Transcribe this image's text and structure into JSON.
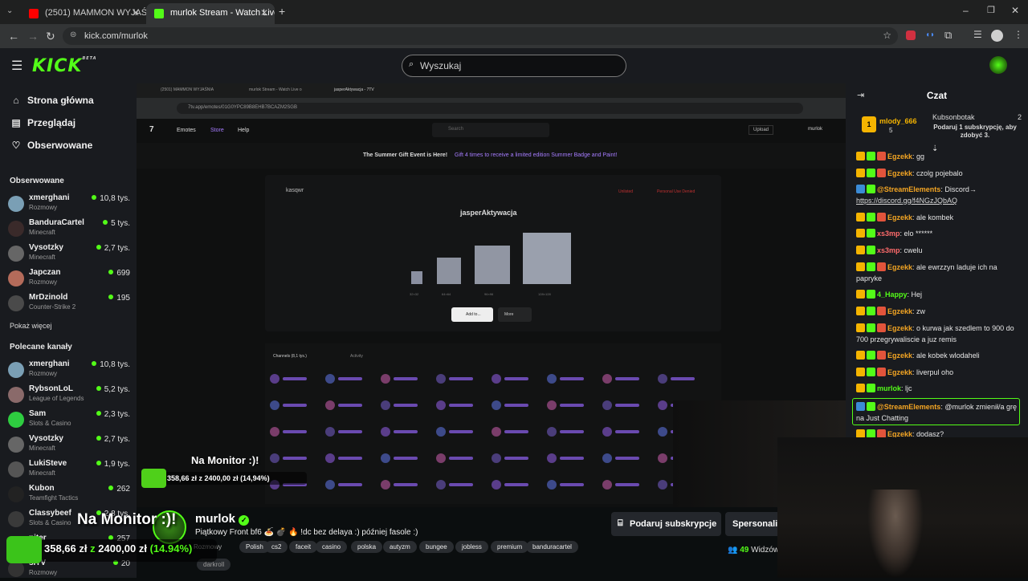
{
  "browser": {
    "tabs": [
      {
        "label": "(2501) MAMMON WYJAŚNIA ST",
        "active": false,
        "color": "#ff0000"
      },
      {
        "label": "murlok Stream - Watch Live on",
        "active": true,
        "color": "#53fc18"
      }
    ],
    "url": "kick.com/murlok"
  },
  "header": {
    "logo": "KICK",
    "logo_beta": "BETA",
    "search_placeholder": "Wyszukaj"
  },
  "sidebar": {
    "nav": [
      {
        "label": "Strona główna",
        "icon": "home-icon"
      },
      {
        "label": "Przeglądaj",
        "icon": "browse-icon"
      },
      {
        "label": "Obserwowane",
        "icon": "heart-icon"
      }
    ],
    "followed_title": "Obserwowane",
    "followed": [
      {
        "name": "xmerghani",
        "category": "Rozmowy",
        "viewers": "10,8 tys.",
        "color": "#7a9fb5"
      },
      {
        "name": "BanduraCartel",
        "category": "Minecraft",
        "viewers": "5 tys.",
        "color": "#3a2a2a"
      },
      {
        "name": "Vysotzky",
        "category": "Minecraft",
        "viewers": "2,7 tys.",
        "color": "#666"
      },
      {
        "name": "Japczan",
        "category": "Rozmowy",
        "viewers": "699",
        "color": "#b46b5a"
      },
      {
        "name": "MrDzinold",
        "category": "Counter-Strike 2",
        "viewers": "195",
        "color": "#4a4a4a"
      }
    ],
    "show_more": "Pokaż więcej",
    "recommended_title": "Polecane kanały",
    "recommended": [
      {
        "name": "xmerghani",
        "category": "Rozmowy",
        "viewers": "10,8 tys.",
        "color": "#7a9fb5"
      },
      {
        "name": "RybsonLoL",
        "category": "League of Legends",
        "viewers": "5,2 tys.",
        "color": "#8a6a6a"
      },
      {
        "name": "Sam",
        "category": "Slots & Casino",
        "viewers": "2,3 tys.",
        "color": "#2ecc40"
      },
      {
        "name": "Vysotzky",
        "category": "Minecraft",
        "viewers": "2,7 tys.",
        "color": "#666"
      },
      {
        "name": "LukiSteve",
        "category": "Minecraft",
        "viewers": "1,9 tys.",
        "color": "#555"
      },
      {
        "name": "Kubon",
        "category": "Teamfight Tactics",
        "viewers": "262",
        "color": "#222"
      },
      {
        "name": "Classybeef",
        "category": "Slots & Casino",
        "viewers": "2,8 tys.",
        "color": "#3a3a3a"
      },
      {
        "name": "piter",
        "category": "",
        "viewers": "257",
        "color": "#444"
      },
      {
        "name": "sITV",
        "category": "Rozmowy",
        "viewers": "20",
        "color": "#333"
      }
    ]
  },
  "stream": {
    "inner_browser": {
      "tabs": [
        "(2501) MAMMON WYJAŚNIA",
        "murlok Stream - Watch Live o",
        "jasperAktywacja - 7TV"
      ],
      "url": "7tv.app/emotes/01G0YPC89B8EHB7BCAZM2SGB",
      "nav": [
        "Emotes",
        "Store",
        "Help"
      ],
      "search": "Search",
      "upload": "Upload",
      "user": "murlok",
      "banner": "The Summer Gift Event is Here!",
      "banner_link": "Gift 4 times to receive a limited edition Summer Badge and Paint!",
      "author": "kasqwr",
      "emote_name": "jasperAktywacja",
      "sizes": [
        "32×32",
        "64×64",
        "96×96",
        "128×128"
      ],
      "add_btn": "Add to...",
      "more_btn": "More",
      "channels_tab": "Channels (8,1 tys.)",
      "activity_tab": "Activity",
      "report": "Unlisted",
      "personal": "Personal Use Denied"
    },
    "overlay_small": "Na Monitor :)!",
    "overlay_small_progress": "358,66 zł z 2400,00 zł (14,94%)"
  },
  "info": {
    "streamer": "murlok",
    "title": "Piątkowy Front bf6 🍝 💣 🔥 !dc bez delaya :) później fasole :)",
    "tags": [
      "Rozmowy",
      "Polish",
      "cs2",
      "faceit",
      "casino",
      "polska",
      "autyzm",
      "bungee",
      "jobless",
      "premium",
      "banduracartel",
      "darkroll"
    ],
    "sub_button": "Podaruj subskrypcje",
    "sponsor_button": "Spersonalizuj",
    "viewers_count": "49",
    "viewers_label": "Widzów"
  },
  "overlay": {
    "title": "Na Monitor :)!",
    "amount": "358,66 zł",
    "z": "z",
    "goal": "2400,00 zł",
    "pct": "(14.94%)",
    "progress": 0.1494
  },
  "chat": {
    "title": "Czat",
    "top_gifter": {
      "name": "mlody_666",
      "rank": "1",
      "count": "5"
    },
    "bot": {
      "name": "Kubsonbotak",
      "count": "2",
      "text": "Podaruj 1 subskrypcję, aby zdobyć 3."
    },
    "messages": [
      {
        "user": "Egzekk",
        "color": "#f5a623",
        "text": "gg"
      },
      {
        "user": "Egzekk",
        "color": "#f5a623",
        "text": "czolg pojebalo"
      },
      {
        "user": "@StreamElements",
        "color": "#f5a623",
        "text": "Discord→",
        "link": "https://discord.gg/f4NGzJQbAQ"
      },
      {
        "user": "Egzekk",
        "color": "#f5a623",
        "text": "ale kombek"
      },
      {
        "user": "xs3mp",
        "color": "#ff6b6b",
        "text": "elo ******"
      },
      {
        "user": "xs3mp",
        "color": "#ff6b6b",
        "text": "cwelu"
      },
      {
        "user": "Egzekk",
        "color": "#f5a623",
        "text": "ale ewrzzyn laduje ich na papryke"
      },
      {
        "user": "4_Happy",
        "color": "#53fc18",
        "text": "Hej"
      },
      {
        "user": "Egzekk",
        "color": "#f5a623",
        "text": "zw"
      },
      {
        "user": "Egzekk",
        "color": "#f5a623",
        "text": "o kurwa jak szedlem to 900 do 700 przegrywaliscie a juz remis"
      },
      {
        "user": "Egzekk",
        "color": "#f5a623",
        "text": "ale kobek wlodaheli"
      },
      {
        "user": "Egzekk",
        "color": "#f5a623",
        "text": "liverpul oho"
      },
      {
        "user": "murlok",
        "color": "#53fc18",
        "text": "ljc"
      },
      {
        "user": "@StreamElements",
        "color": "#f5a623",
        "text": "@murlok zmienił/a grę na Just Chatting"
      },
      {
        "user": "Egzekk",
        "color": "#f5a623",
        "text": "dodasz?"
      }
    ]
  },
  "colors": {
    "accent": "#53fc18",
    "bg": "#0b0e0f",
    "panel": "#191b1f"
  }
}
